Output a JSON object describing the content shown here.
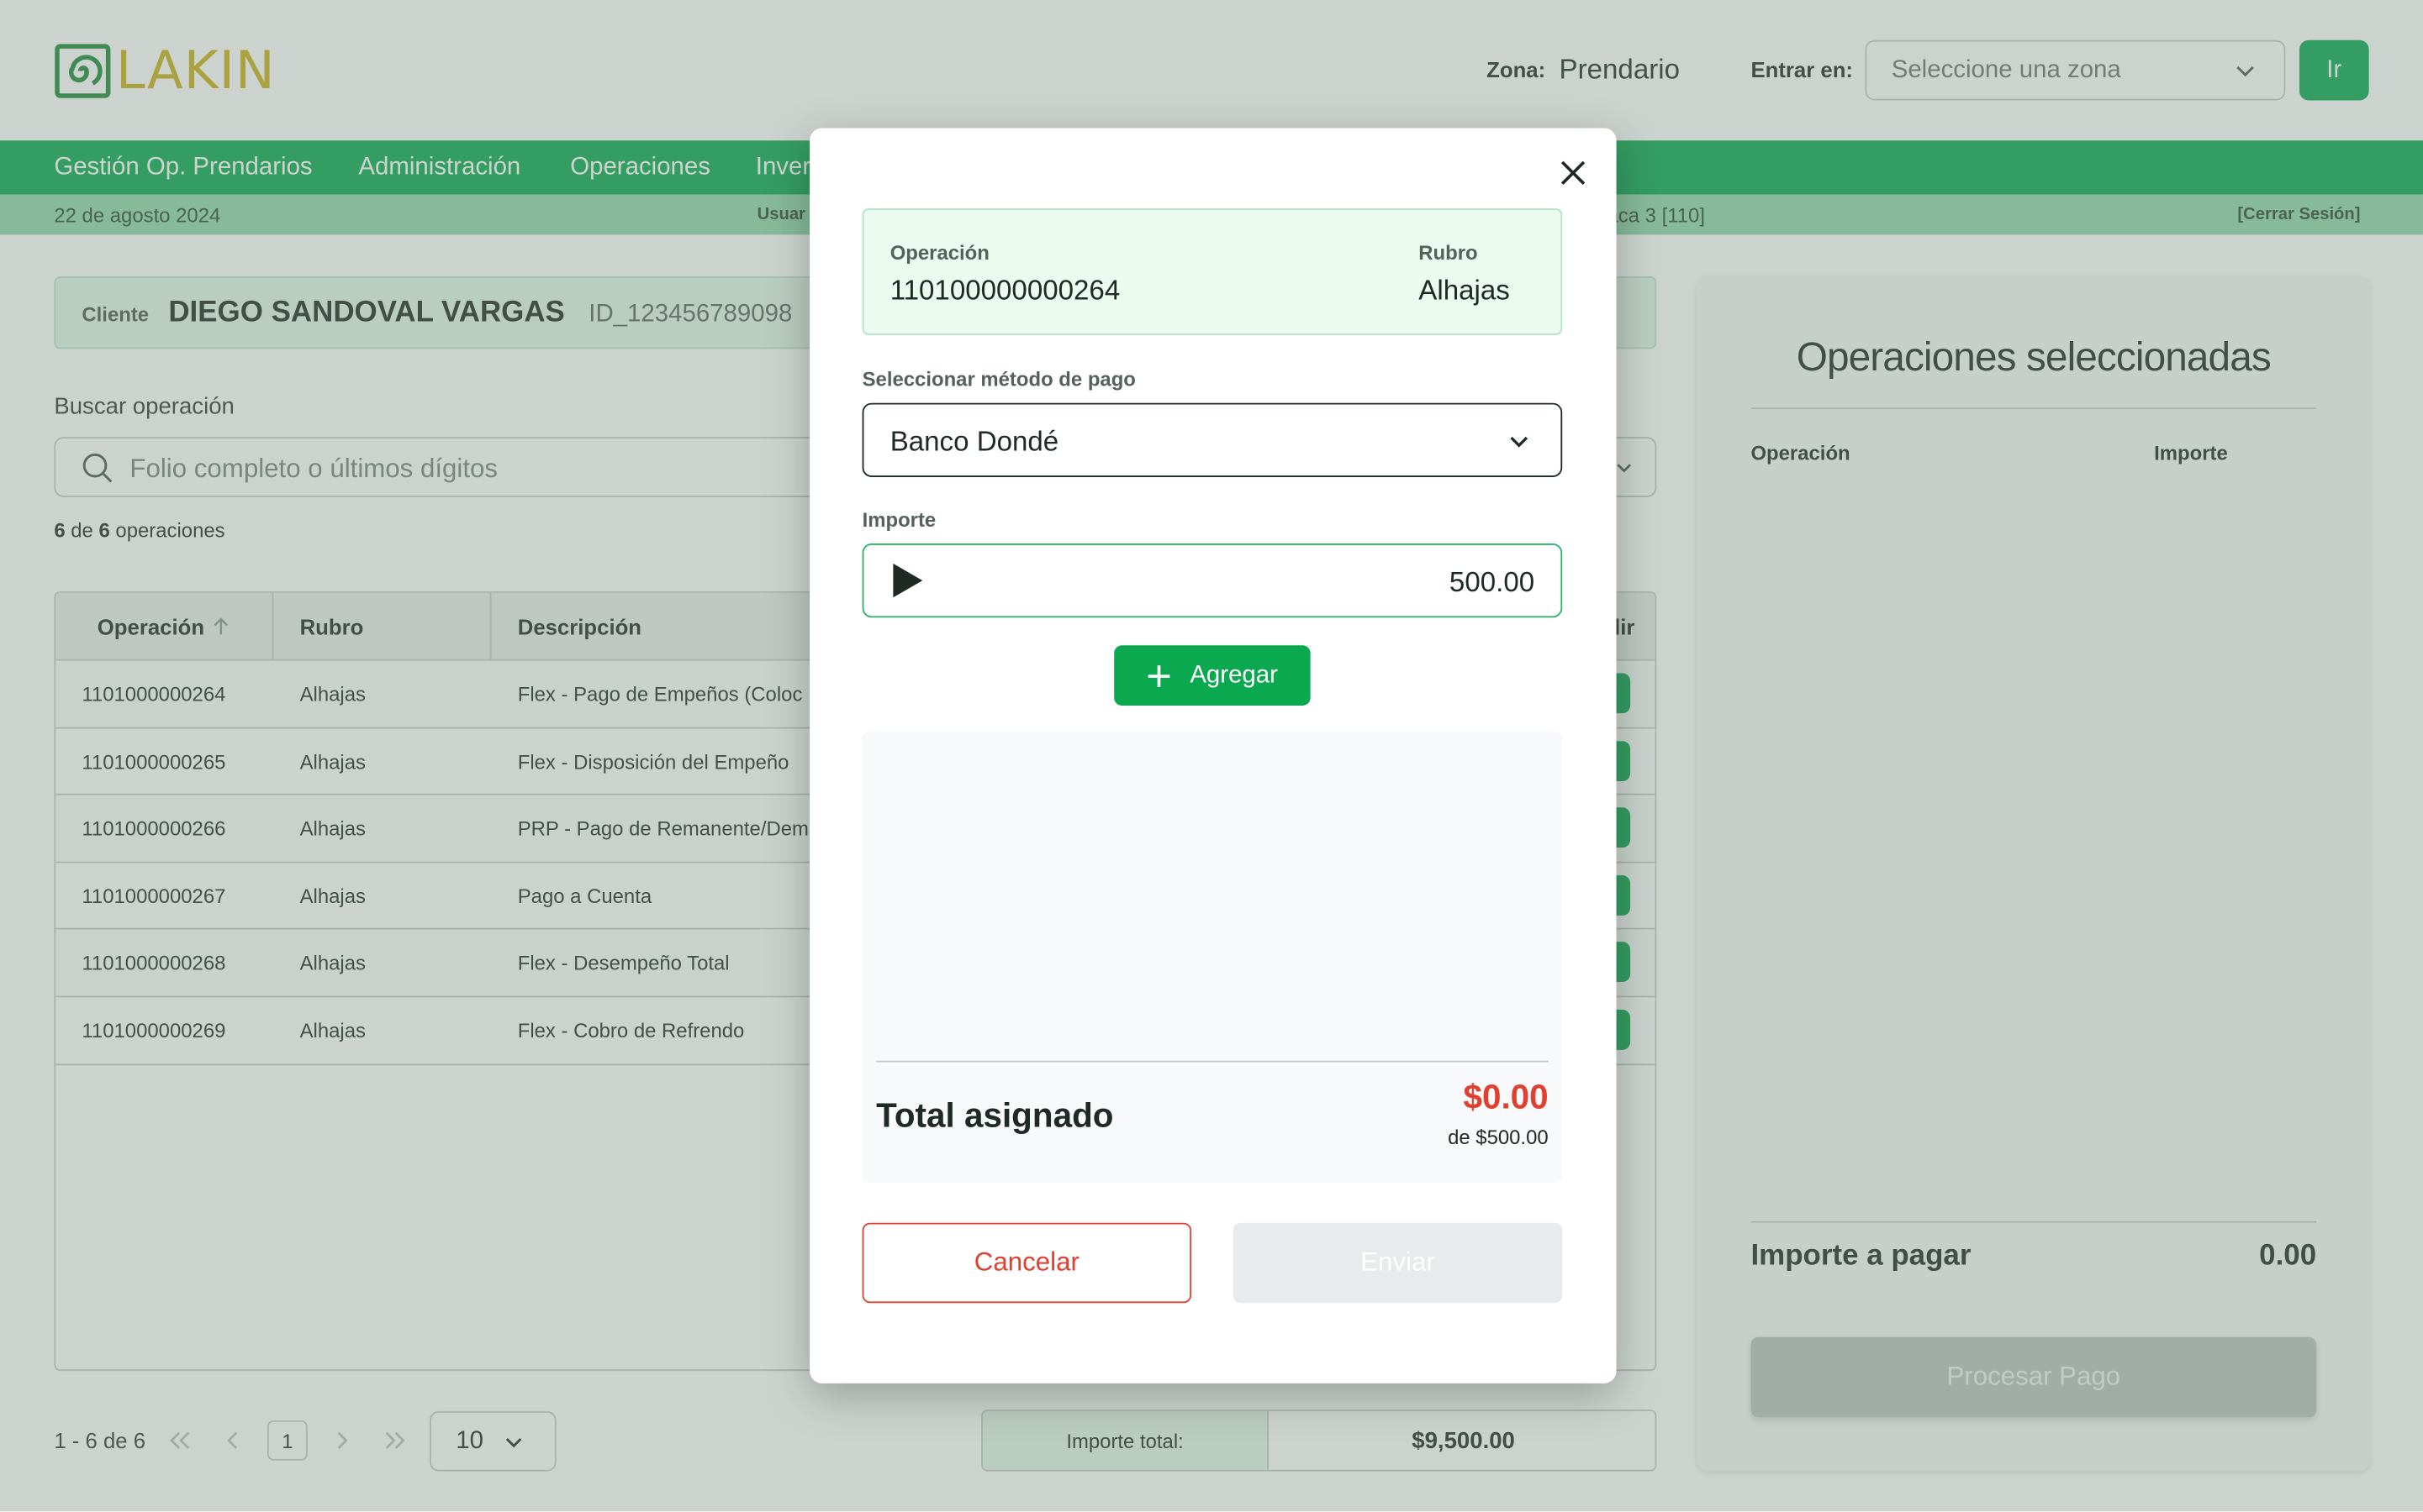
{
  "header": {
    "logo_text": "LAKIN",
    "zona_label": "Zona:",
    "zona_value": "Prendario",
    "entrar_label": "Entrar en:",
    "zona_select_placeholder": "Seleccione una zona",
    "ir_label": "Ir"
  },
  "nav": {
    "items": [
      "Gestión Op. Prendarios",
      "Administración",
      "Operaciones",
      "Inver"
    ]
  },
  "subbar": {
    "date": "22 de agosto 2024",
    "user_partial": "Usuar",
    "branch_partial": "aca 3 [110]",
    "logout": "[Cerrar Sesión]"
  },
  "client": {
    "label": "Cliente",
    "name": "DIEGO SANDOVAL VARGAS",
    "id": "ID_123456789098"
  },
  "search": {
    "label": "Buscar operación",
    "placeholder": "Folio completo o últimos dígitos"
  },
  "count": {
    "shown": "6",
    "middle": " de ",
    "total": "6",
    "suffix": " operaciones"
  },
  "table": {
    "headers": [
      "Operación",
      "Rubro",
      "Descripción",
      "dir"
    ],
    "rows": [
      [
        "1101000000264",
        "Alhajas",
        "Flex - Pago de Empeños (Coloc"
      ],
      [
        "1101000000265",
        "Alhajas",
        "Flex - Disposición del Empeño"
      ],
      [
        "1101000000266",
        "Alhajas",
        "PRP - Pago de Remanente/Dem"
      ],
      [
        "1101000000267",
        "Alhajas",
        "Pago a Cuenta"
      ],
      [
        "1101000000268",
        "Alhajas",
        "Flex - Desempeño Total"
      ],
      [
        "1101000000269",
        "Alhajas",
        "Flex - Cobro de Refrendo"
      ]
    ]
  },
  "pagination": {
    "range": "1 - 6 de 6",
    "page": "1",
    "page_size": "10"
  },
  "totals": {
    "label": "Importe total:",
    "value": "$9,500.00"
  },
  "side": {
    "title": "Operaciones seleccionadas",
    "col_operacion": "Operación",
    "col_importe": "Importe",
    "pay_label": "Importe a pagar",
    "pay_value": "0.00",
    "process_label": "Procesar Pago"
  },
  "modal": {
    "op_label": "Operación",
    "op_value": "110100000000264",
    "rubro_label": "Rubro",
    "rubro_value": "Alhajas",
    "method_label": "Seleccionar método de pago",
    "method_value": "Banco Dondé",
    "amount_label": "Importe",
    "amount_value": "500.00",
    "add_label": "Agregar",
    "total_label": "Total asignado",
    "total_value": "$0.00",
    "total_of": "de  $500.00",
    "cancel_label": "Cancelar",
    "send_label": "Enviar"
  },
  "colors": {
    "brand_green": "#0aa84f",
    "logo_yellow": "#c9b01a",
    "danger_red": "#e0402f"
  }
}
